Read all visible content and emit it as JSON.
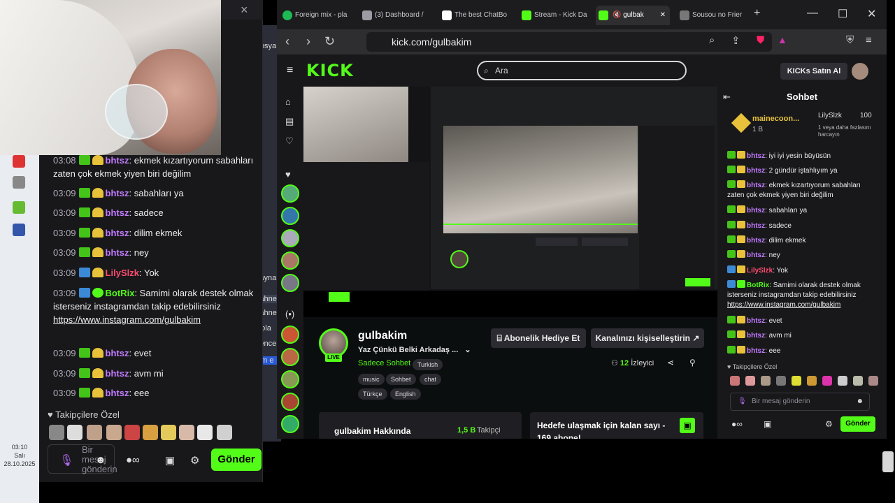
{
  "left_popout": {
    "close_label": "×",
    "messages": [
      {
        "time": "03:08",
        "user": "bhtsz",
        "text": "ekmek kızartıyorum sabahları zaten çok ekmek yiyen biri değilim"
      },
      {
        "time": "03:09",
        "user": "bhtsz",
        "text": "sabahları ya"
      },
      {
        "time": "03:09",
        "user": "bhtsz",
        "text": "sadece"
      },
      {
        "time": "03:09",
        "user": "bhtsz",
        "text": "dilim ekmek"
      },
      {
        "time": "03:09",
        "user": "bhtsz",
        "text": "ney"
      },
      {
        "time": "03:09",
        "user": "LilySlzk",
        "text": "Yok"
      },
      {
        "time": "03:09",
        "user": "BotRix",
        "text": "Samimi olarak destek olmak isterseniz instagramdan takip edebilirsiniz",
        "link": "https://www.instagram.com/gulbakim"
      },
      {
        "time": "03:09",
        "user": "bhtsz",
        "text": "evet"
      },
      {
        "time": "03:09",
        "user": "bhtsz",
        "text": "avm mi"
      },
      {
        "time": "03:09",
        "user": "bhtsz",
        "text": "eee"
      }
    ],
    "emotes_title": "Takipçilere Özel",
    "input_placeholder": "Bir mesaj gönderin",
    "send_label": "Gönder"
  },
  "taskbar": {
    "time": "03:10",
    "day": "Salı",
    "date": "28.10.2025"
  },
  "obs": {
    "menu": "Dosya",
    "rows": [
      "Kayna",
      "Sahne",
      "Sahne",
      "mola",
      "Pence",
      "tam e"
    ]
  },
  "browser": {
    "tabs": [
      {
        "label": "Foreign mix - pla",
        "color": "#1db954"
      },
      {
        "label": "(3) Dashboard /",
        "color": "#9b9ba3"
      },
      {
        "label": "The best ChatBo",
        "color": "#ffffff"
      },
      {
        "label": "Stream - Kick Da",
        "color": "#53fc18"
      },
      {
        "label": "gulbak",
        "color": "#53fc18"
      },
      {
        "label": "Sousou no Frier",
        "color": "#aaaaaa"
      }
    ],
    "url": "kick.com/gulbakim"
  },
  "kick": {
    "logo": "KICK",
    "search_placeholder": "Ara",
    "kicks_button": "KICKs Satın Al",
    "channel": {
      "name": "gulbakim",
      "title": "Yaz Çünkü Belki Arkadaş ...",
      "category": "Sadece Sohbet",
      "language_tag": "Turkish",
      "tags": [
        "music",
        "Sohbet",
        "chat",
        "Türkçe",
        "English"
      ],
      "live": "LIVE",
      "viewers": "12",
      "viewers_label": "İzleyici",
      "gift_button": "Abonelik Hediye Et",
      "customize_button": "Kanalınızı kişiselleştirin",
      "about_title": "gulbakim Hakkında",
      "followers": "1,5 B",
      "followers_label": "Takipçi",
      "goal_text": "Hedefe ulaşmak için kalan sayı - 169 abone!"
    },
    "chat": {
      "title": "Sohbet",
      "top_gifter": "mainecoon...",
      "top_gifter_amount": "1 B",
      "leader": "LilySlzk",
      "leader_amount": "100",
      "leader_note": "1 veya daha fazlasını harcayın",
      "messages": [
        {
          "user": "bhtsz",
          "text": "iyi iyi yesin büyüsün"
        },
        {
          "user": "bhtsz",
          "text": "2 gündür iştahlıyım ya"
        },
        {
          "user": "bhtsz",
          "text": "ekmek kızartıyorum sabahları zaten çok ekmek yiyen biri değilim"
        },
        {
          "user": "bhtsz",
          "text": "sabahları ya"
        },
        {
          "user": "bhtsz",
          "text": "sadece"
        },
        {
          "user": "bhtsz",
          "text": "dilim ekmek"
        },
        {
          "user": "bhtsz",
          "text": "ney"
        },
        {
          "user": "LilySlzk",
          "text": "Yok"
        },
        {
          "user": "BotRix",
          "text": "Samimi olarak destek olmak isterseniz instagramdan takip edebilirsiniz",
          "link": "https://www.instagram.com/gulbakim"
        },
        {
          "user": "bhtsz",
          "text": "evet"
        },
        {
          "user": "bhtsz",
          "text": "avm mi"
        },
        {
          "user": "bhtsz",
          "text": "eee"
        }
      ],
      "emotes_title": "Takipçilere Özel",
      "input_placeholder": "Bir mesaj gönderin",
      "send_label": "Gönder"
    }
  },
  "colors": {
    "kick_green": "#53fc18",
    "purple_user": "#c27cff",
    "red_user": "#ff4b6e"
  }
}
